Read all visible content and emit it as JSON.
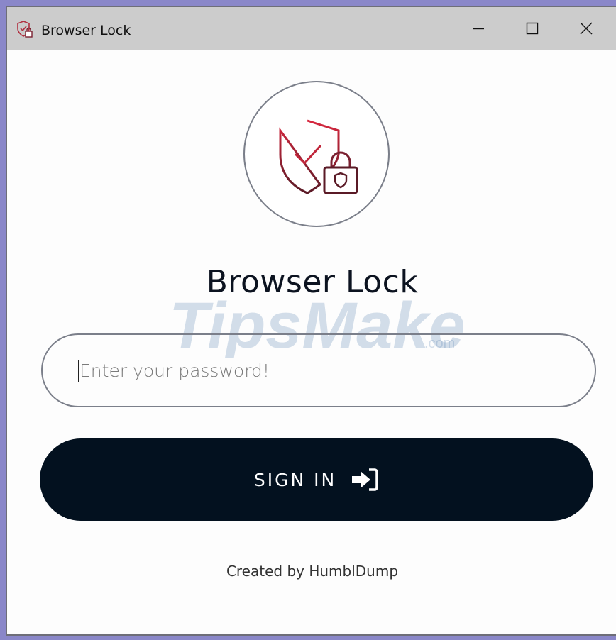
{
  "window": {
    "title": "Browser Lock",
    "controls": {
      "minimize": "minimize",
      "maximize": "maximize",
      "close": "close"
    }
  },
  "app": {
    "logo_icon": "shield-check-lock-icon",
    "heading": "Browser Lock"
  },
  "form": {
    "password_placeholder": "Enter your password!",
    "password_value": "",
    "signin_label": "SIGN IN",
    "signin_icon": "sign-in-icon"
  },
  "footer": {
    "credit": "Created by HumblDump"
  },
  "watermark": {
    "text_main": "TipsMake",
    "text_suffix": ".com"
  },
  "colors": {
    "titlebar": "#cccccc",
    "button_bg": "#03111f",
    "accent_red": "#c0253a",
    "frame": "#8a87c9"
  }
}
